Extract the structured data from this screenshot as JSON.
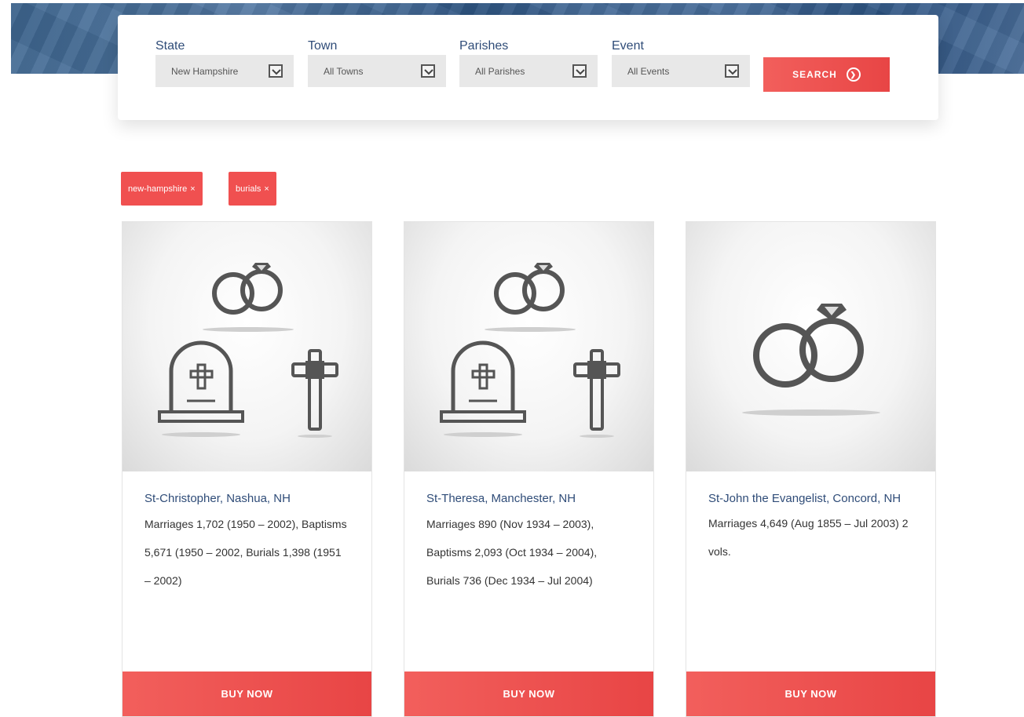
{
  "search": {
    "fields": [
      {
        "label": "State",
        "value": "New Hampshire"
      },
      {
        "label": "Town",
        "value": "All Towns"
      },
      {
        "label": "Parishes",
        "value": "All Parishes"
      },
      {
        "label": "Event",
        "value": "All Events"
      }
    ],
    "button_label": "SEARCH",
    "button_icon": "arrow-circle-icon"
  },
  "filters": [
    {
      "label": "new-hampshire",
      "remove": "×"
    },
    {
      "label": "burials",
      "remove": "×"
    }
  ],
  "cards": [
    {
      "title": "St-Christopher, Nashua, NH",
      "description": "Marriages 1,702 (1950 – 2002), Baptisms 5,671 (1950 – 2002, Burials 1,398 (1951 – 2002)",
      "icons": [
        "wedding-rings-icon",
        "tombstone-icon",
        "cross-icon"
      ],
      "button_label": "BUY NOW"
    },
    {
      "title": "St-Theresa, Manchester, NH",
      "description": "Marriages 890 (Nov 1934 – 2003), Baptisms 2,093 (Oct 1934 – 2004), Burials 736 (Dec 1934 – Jul 2004)",
      "icons": [
        "wedding-rings-icon",
        "tombstone-icon",
        "cross-icon"
      ],
      "button_label": "BUY NOW"
    },
    {
      "title": "St-John the Evangelist, Concord, NH",
      "description": "Marriages 4,649 (Aug 1855 – Jul 2003) 2 vols.",
      "icons": [
        "wedding-rings-icon"
      ],
      "button_label": "BUY NOW"
    }
  ],
  "colors": {
    "accent": "#f05050",
    "label_blue": "#2f4c78",
    "icon_gray": "#555555"
  }
}
